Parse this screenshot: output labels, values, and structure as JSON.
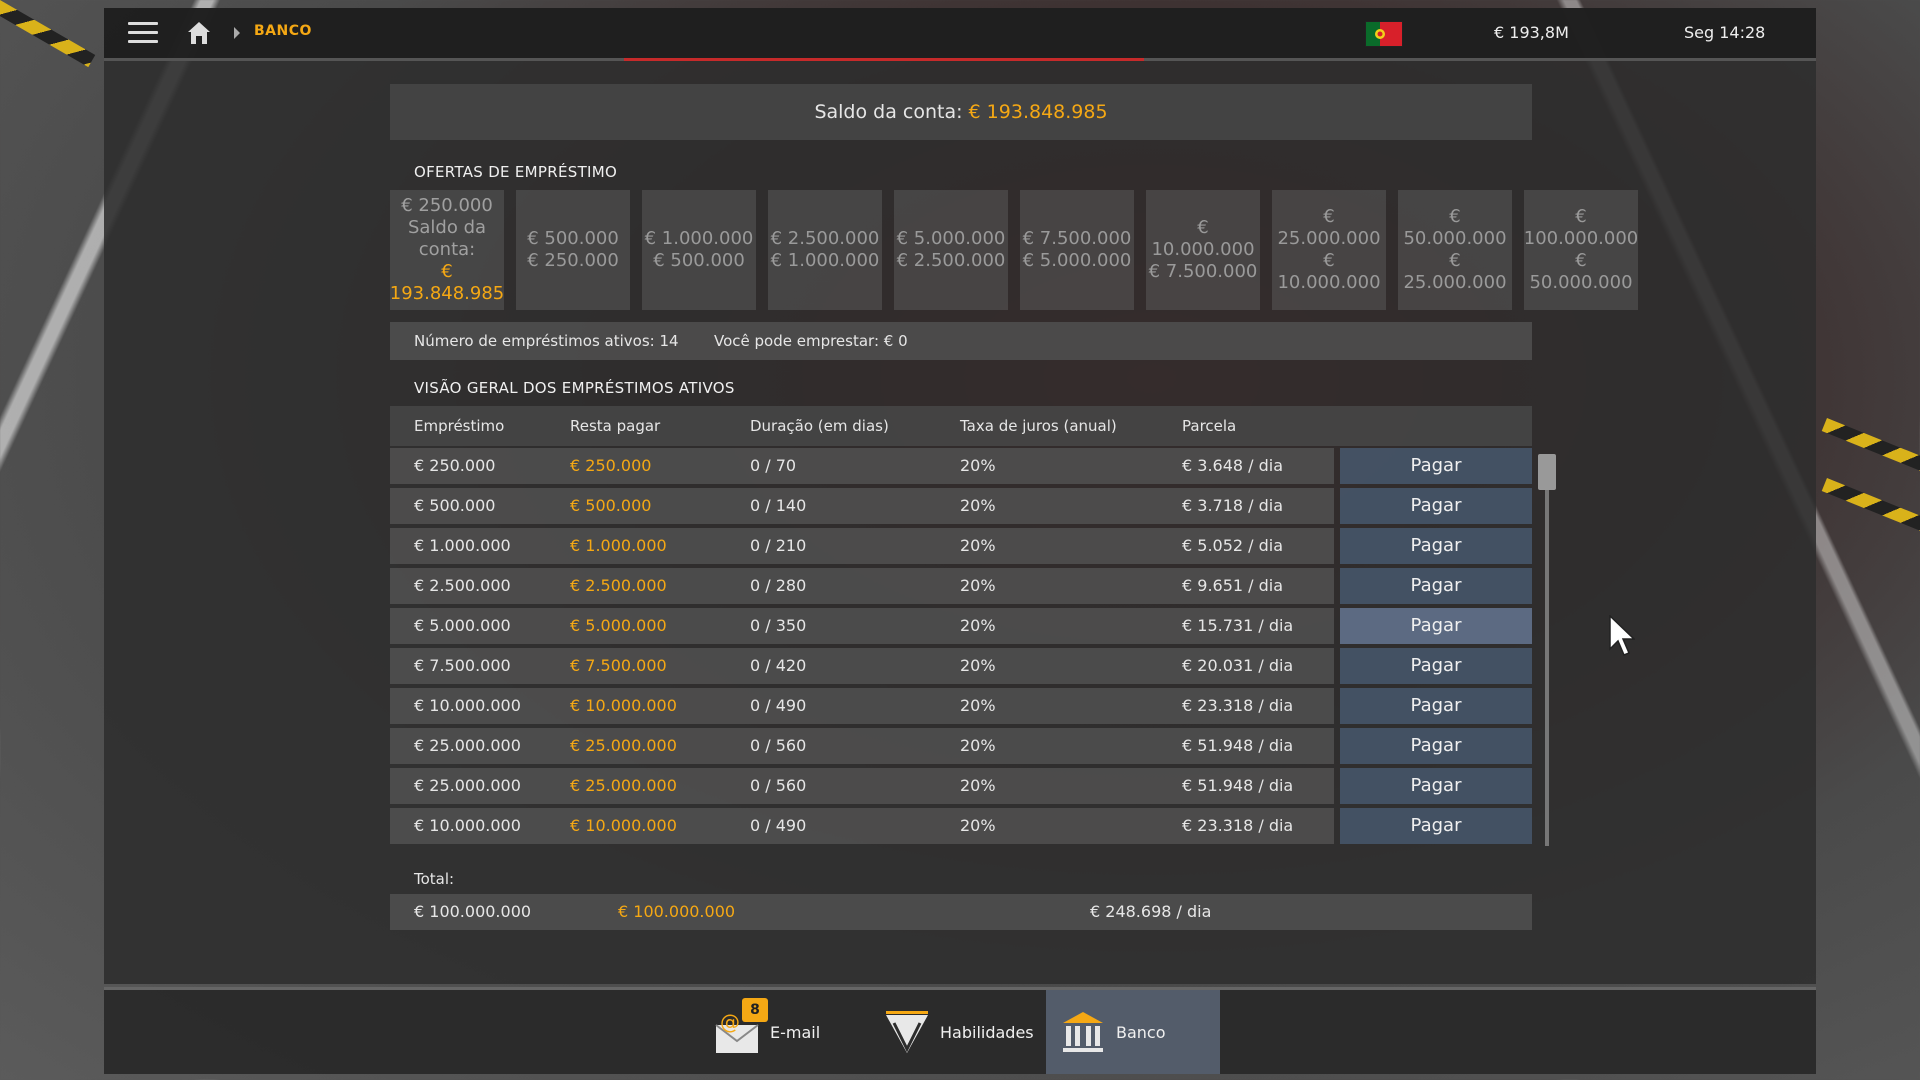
{
  "topbar": {
    "breadcrumb": "BANCO",
    "money": "€ 193,8M",
    "clock": "Seg 14:28"
  },
  "balance": {
    "label": "Saldo da conta: ",
    "value": "€ 193.848.985"
  },
  "offers": {
    "title": "OFERTAS DE EMPRÉSTIMO",
    "items": [
      {
        "line1": "€ 250.000",
        "line2": "Saldo da conta:",
        "line3": "€ 193.848.985"
      },
      {
        "line1": "€ 500.000",
        "line2": "€ 250.000"
      },
      {
        "line1": "€ 1.000.000",
        "line2": "€ 500.000"
      },
      {
        "line1": "€ 2.500.000",
        "line2": "€ 1.000.000"
      },
      {
        "line1": "€ 5.000.000",
        "line2": "€ 2.500.000"
      },
      {
        "line1": "€ 7.500.000",
        "line2": "€ 5.000.000"
      },
      {
        "line1": "€ 10.000.000",
        "line2": "€ 7.500.000"
      },
      {
        "line1": "€ 25.000.000",
        "line2": "€ 10.000.000"
      },
      {
        "line1": "€ 50.000.000",
        "line2": "€ 25.000.000"
      },
      {
        "line1": "€ 100.000.000",
        "line2": "€ 50.000.000"
      }
    ]
  },
  "info": {
    "active_loans": "Número de empréstimos ativos: 14",
    "can_borrow": "Você pode emprestar: € 0"
  },
  "overview": {
    "title": "VISÃO GERAL DOS EMPRÉSTIMOS ATIVOS",
    "headers": [
      "Empréstimo",
      "Resta pagar",
      "Duração (em dias)",
      "Taxa de juros (anual)",
      "Parcela"
    ],
    "pay_label": "Pagar",
    "rows": [
      {
        "loan": "€ 250.000",
        "remaining": "€ 250.000",
        "duration": "0 / 70",
        "rate": "20%",
        "installment": "€ 3.648 / dia"
      },
      {
        "loan": "€ 500.000",
        "remaining": "€ 500.000",
        "duration": "0 / 140",
        "rate": "20%",
        "installment": "€ 3.718 / dia"
      },
      {
        "loan": "€ 1.000.000",
        "remaining": "€ 1.000.000",
        "duration": "0 / 210",
        "rate": "20%",
        "installment": "€ 5.052 / dia"
      },
      {
        "loan": "€ 2.500.000",
        "remaining": "€ 2.500.000",
        "duration": "0 / 280",
        "rate": "20%",
        "installment": "€ 9.651 / dia"
      },
      {
        "loan": "€ 5.000.000",
        "remaining": "€ 5.000.000",
        "duration": "0 / 350",
        "rate": "20%",
        "installment": "€ 15.731 / dia"
      },
      {
        "loan": "€ 7.500.000",
        "remaining": "€ 7.500.000",
        "duration": "0 / 420",
        "rate": "20%",
        "installment": "€ 20.031 / dia"
      },
      {
        "loan": "€ 10.000.000",
        "remaining": "€ 10.000.000",
        "duration": "0 / 490",
        "rate": "20%",
        "installment": "€ 23.318 / dia"
      },
      {
        "loan": "€ 25.000.000",
        "remaining": "€ 25.000.000",
        "duration": "0 / 560",
        "rate": "20%",
        "installment": "€ 51.948 / dia"
      },
      {
        "loan": "€ 25.000.000",
        "remaining": "€ 25.000.000",
        "duration": "0 / 560",
        "rate": "20%",
        "installment": "€ 51.948 / dia"
      },
      {
        "loan": "€ 10.000.000",
        "remaining": "€ 10.000.000",
        "duration": "0 / 490",
        "rate": "20%",
        "installment": "€ 23.318 / dia"
      }
    ],
    "total_label": "Total:",
    "total": {
      "loan": "€ 100.000.000",
      "remaining": "€ 100.000.000",
      "installment": "€ 248.698 / dia"
    }
  },
  "bottom": {
    "tabs": [
      {
        "label": "E-mail",
        "badge": "8",
        "icon": "email-icon"
      },
      {
        "label": "Habilidades",
        "icon": "skills-icon"
      },
      {
        "label": "Banco",
        "icon": "bank-icon",
        "active": true
      }
    ]
  },
  "colors": {
    "accent": "#f5a814",
    "pay_button": "#465569",
    "active_tab": "#555f6e"
  }
}
